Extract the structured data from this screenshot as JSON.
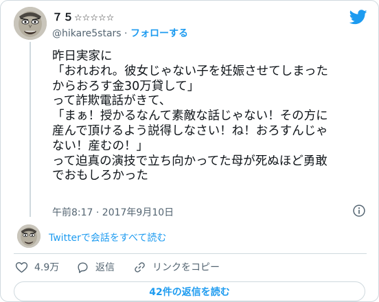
{
  "author": {
    "name": "７５",
    "name_decoration": "☆☆☆☆☆",
    "handle": "@hikare5stars",
    "separator": "·",
    "follow_label": "フォローする"
  },
  "tweet": {
    "lines": [
      "昨日実家に",
      "「おれおれ。彼女じゃない子を妊娠させてしまった",
      "からおろす金30万貸して」",
      "って詐欺電話がきて、",
      "「まぁ！授かるなんて素敵な話じゃない！その方に",
      "産んで頂けるよう説得しなさい！ね！おろすんじゃ",
      "ない！産むの！」",
      "って迫真の演技で立ち向かってた母が死ぬほど勇敢",
      "でおもしろかった"
    ],
    "timestamp": "午前8:17 · 2017年9月10日"
  },
  "conversation_link": "Twitterで会話をすべて読む",
  "actions": {
    "like_count": "4.9万",
    "reply_label": "返信",
    "copy_link_label": "リンクをコピー"
  },
  "read_replies_label": "42件の返信を読む",
  "icons": {
    "brand": "twitter-bird-icon",
    "info": "info-icon",
    "like": "heart-icon",
    "reply": "reply-bubble-icon",
    "copy": "link-icon"
  },
  "colors": {
    "accent": "#1d9bf0",
    "muted": "#536471",
    "border": "#cfd9de",
    "text": "#0f1419"
  }
}
